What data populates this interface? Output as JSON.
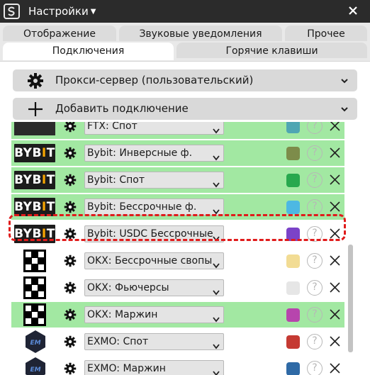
{
  "window": {
    "title": "Настройки",
    "app_icon": "app-logo-icon",
    "close_icon": "close-icon"
  },
  "tabs": [
    {
      "label": "Отображение",
      "active": false
    },
    {
      "label": "Звуковые уведомления",
      "active": false
    },
    {
      "label": "Прочее",
      "active": false
    },
    {
      "label": "Подключения",
      "active": true
    },
    {
      "label": "Горячие клавиши",
      "active": false
    }
  ],
  "sections": {
    "proxy": {
      "label": "Прокси-сервер (пользовательский)",
      "icon": "gear-icon"
    },
    "add_connection": {
      "label": "Добавить подключение",
      "icon": "plus-icon"
    }
  },
  "connections": [
    {
      "exchange": "FTX",
      "selected": "FTX: Спот",
      "color": "#4fa6b3",
      "highlighted": true,
      "logo": "ftx-logo"
    },
    {
      "exchange": "Bybit",
      "selected": "Bybit: Инверсные ф.",
      "color": "#7d8c4a",
      "highlighted": true,
      "logo": "bybit-logo"
    },
    {
      "exchange": "Bybit",
      "selected": "Bybit: Спот",
      "color": "#28a84e",
      "highlighted": true,
      "logo": "bybit-logo"
    },
    {
      "exchange": "Bybit",
      "selected": "Bybit: Бессрочные ф.",
      "color": "#4db8e3",
      "highlighted": true,
      "logo": "bybit-logo"
    },
    {
      "exchange": "Bybit",
      "selected": "Bybit: USDC Бессрочные",
      "color": "#7b43c8",
      "highlighted": false,
      "logo": "bybit-logo"
    },
    {
      "exchange": "OKX",
      "selected": "OKX: Бессрочные свопы",
      "color": "#f2dc94",
      "highlighted": false,
      "logo": "okx-logo"
    },
    {
      "exchange": "OKX",
      "selected": "OKX: Фьючерсы",
      "color": "#e6e6e6",
      "highlighted": false,
      "logo": "okx-logo"
    },
    {
      "exchange": "OKX",
      "selected": "OKX: Маржин",
      "color": "#b745ad",
      "highlighted": true,
      "logo": "okx-logo"
    },
    {
      "exchange": "EXMO",
      "selected": "EXMO: Спот",
      "color": "#c53a33",
      "highlighted": false,
      "logo": "exmo-logo"
    },
    {
      "exchange": "EXMO",
      "selected": "EXMO: Маржин",
      "color": "#2f6aa6",
      "highlighted": false,
      "logo": "exmo-logo"
    }
  ],
  "logo_text": {
    "bybit_a": "BYB",
    "bybit_i": "I",
    "bybit_b": "T"
  },
  "help_glyph": "?",
  "colors": {
    "titlebar": "#2b2b2b",
    "row_highlight": "#a2e8a2",
    "focus_outline": "#e01b1b"
  }
}
